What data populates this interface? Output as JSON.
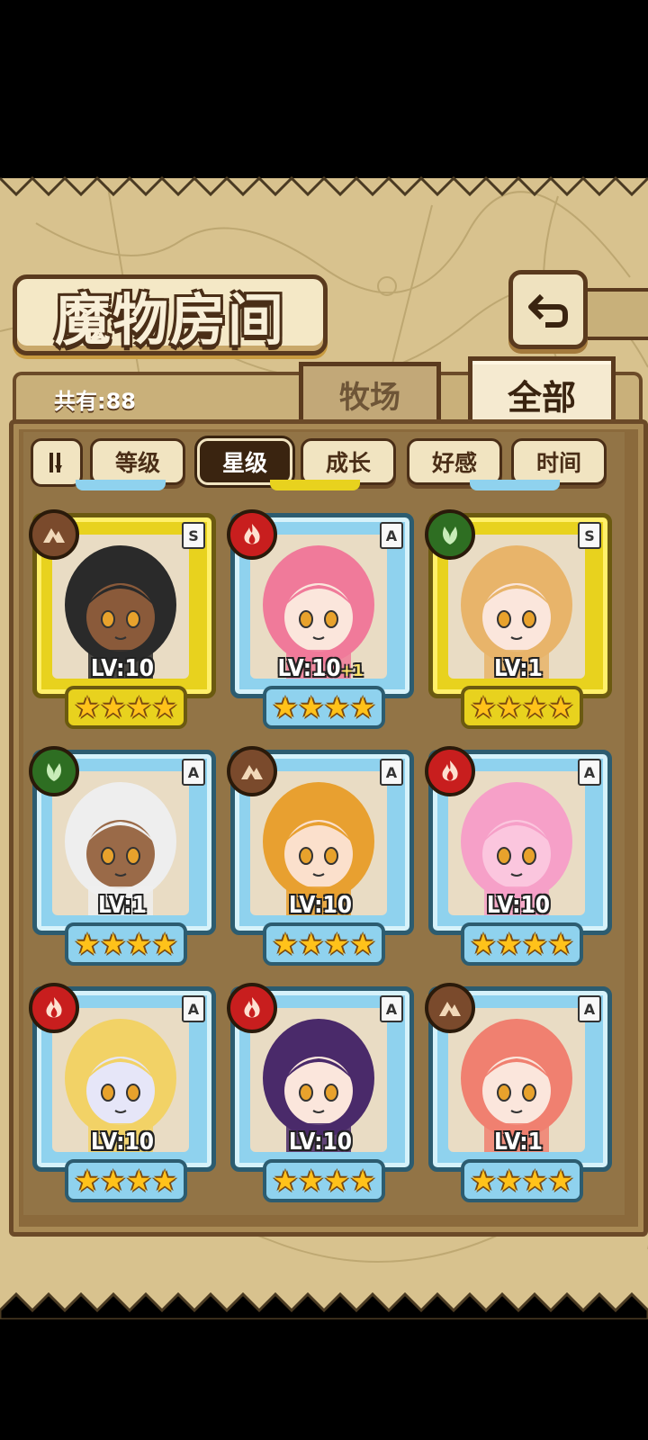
{
  "header": {
    "title": "魔物房间"
  },
  "summary": {
    "total": "共有:88"
  },
  "tabs": [
    {
      "label": "牧场",
      "active": false
    },
    {
      "label": "全部",
      "active": true
    }
  ],
  "sort": {
    "toggle_icon": "sort-order-icon",
    "buttons": [
      {
        "label": "等级",
        "active": false
      },
      {
        "label": "星级",
        "active": true
      },
      {
        "label": "成长",
        "active": false
      },
      {
        "label": "好感",
        "active": false
      },
      {
        "label": "时间",
        "active": false
      }
    ]
  },
  "monsters": [
    {
      "rank": "S",
      "element": "earth",
      "level": "LV:10",
      "bonus": "",
      "stars": 4,
      "frame": "gold",
      "hair": "#2a2a2a",
      "skin": "#8a5a3a"
    },
    {
      "rank": "A",
      "element": "fire",
      "level": "LV:10",
      "bonus": "+1",
      "stars": 4,
      "frame": "blue",
      "hair": "#f07a9a",
      "skin": "#fbe6dc"
    },
    {
      "rank": "S",
      "element": "wood",
      "level": "LV:1",
      "bonus": "",
      "stars": 4,
      "frame": "gold",
      "hair": "#e8b46a",
      "skin": "#fbe6dc"
    },
    {
      "rank": "A",
      "element": "wood",
      "level": "LV:1",
      "bonus": "",
      "stars": 4,
      "frame": "blue",
      "hair": "#eeeeee",
      "skin": "#9a6a48"
    },
    {
      "rank": "A",
      "element": "earth",
      "level": "LV:10",
      "bonus": "",
      "stars": 4,
      "frame": "blue",
      "hair": "#e8a030",
      "skin": "#fbe0cc"
    },
    {
      "rank": "A",
      "element": "fire",
      "level": "LV:10",
      "bonus": "",
      "stars": 4,
      "frame": "blue",
      "hair": "#f6a0c8",
      "skin": "#fbc6de"
    },
    {
      "rank": "A",
      "element": "fire",
      "level": "LV:10",
      "bonus": "",
      "stars": 4,
      "frame": "blue",
      "hair": "#f2d266",
      "skin": "#e6e6f8"
    },
    {
      "rank": "A",
      "element": "fire",
      "level": "LV:10",
      "bonus": "",
      "stars": 4,
      "frame": "blue",
      "hair": "#4a2a6a",
      "skin": "#fbe6dc"
    },
    {
      "rank": "A",
      "element": "earth",
      "level": "LV:1",
      "bonus": "",
      "stars": 4,
      "frame": "blue",
      "hair": "#f08070",
      "skin": "#fbe6dc"
    }
  ]
}
